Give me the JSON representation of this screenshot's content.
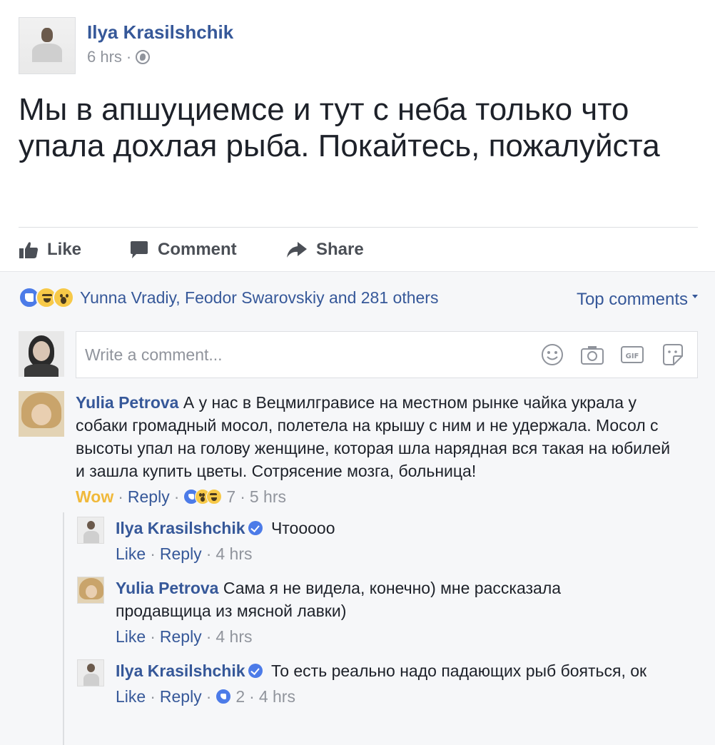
{
  "post": {
    "author": "Ilya Krasilshchik",
    "time": "6 hrs",
    "dot": "·",
    "text": "Мы в апшуциемсе и тут с неба только что упала дохлая рыба. Покайтесь, пожалуйста"
  },
  "actions": {
    "like": "Like",
    "comment": "Comment",
    "share": "Share"
  },
  "reactions": {
    "types": [
      "like-icon",
      "haha-icon",
      "wow-icon"
    ],
    "summary": "Yunna Vradiy, Feodor Swarovskiy and 281 others"
  },
  "sort": {
    "label": "Top comments"
  },
  "writer": {
    "placeholder": "Write a comment...",
    "icons": [
      "emoji-icon",
      "camera-icon",
      "gif-icon",
      "sticker-icon"
    ]
  },
  "comments": [
    {
      "author": "Yulia Petrova",
      "text": "А у нас в Вецмилгрависе на местном рынке чайка украла у собаки громадный мосол, полетела на крышу с ним и не удержала. Мосол с высоты упал на голову женщине, которая шла нарядная вся такая на юбилей и зашла купить цветы. Сотрясение мозга, больница!",
      "reaction_label": "Wow",
      "reply": "Reply",
      "reaction_count": "7",
      "time": "5 hrs"
    },
    {
      "author": "Ilya Krasilshchik",
      "text": "Чтооооо",
      "like": "Like",
      "reply": "Reply",
      "time": "4 hrs"
    },
    {
      "author": "Yulia Petrova",
      "text": "Сама я не видела, конечно) мне рассказала продавщица из мясной лавки)",
      "like": "Like",
      "reply": "Reply",
      "time": "4 hrs"
    },
    {
      "author": "Ilya Krasilshchik",
      "text": "То есть реально надо падающих рыб бояться, ок",
      "like": "Like",
      "reply": "Reply",
      "reaction_count": "2",
      "time": "4 hrs"
    }
  ],
  "separator": "·",
  "colors": {
    "link_blue": "#365899",
    "text": "#1d2129",
    "muted": "#90949c",
    "like_blue": "#4c7be8",
    "wow_yellow": "#f0b93b",
    "comments_bg": "#f6f7f9"
  }
}
